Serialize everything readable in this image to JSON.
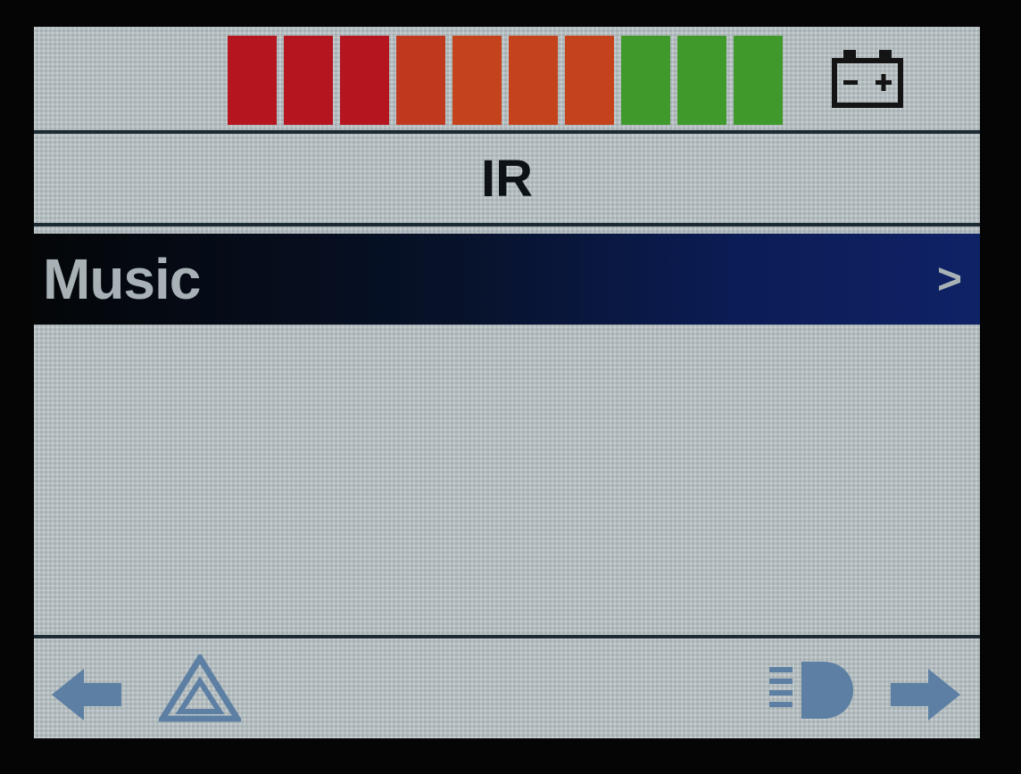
{
  "status": {
    "level_segments": 10,
    "segment_colors": [
      "#b5151e",
      "#b5151e",
      "#b5151e",
      "#c0391f",
      "#c4421c",
      "#c4421c",
      "#c4421c",
      "#3f9a2b",
      "#3f9a2b",
      "#3f9a2b"
    ],
    "battery_icon": "battery-icon"
  },
  "header": {
    "title": "IR"
  },
  "menu": {
    "items": [
      {
        "label": "Music",
        "chevron": ">",
        "selected": true
      }
    ],
    "highlight_color": "#0f2266"
  },
  "footer": {
    "icons": [
      "back-arrow-icon",
      "hazard-triangle-icon",
      "headlight-icon",
      "forward-arrow-icon"
    ],
    "icon_color": "#5c7fa3"
  }
}
